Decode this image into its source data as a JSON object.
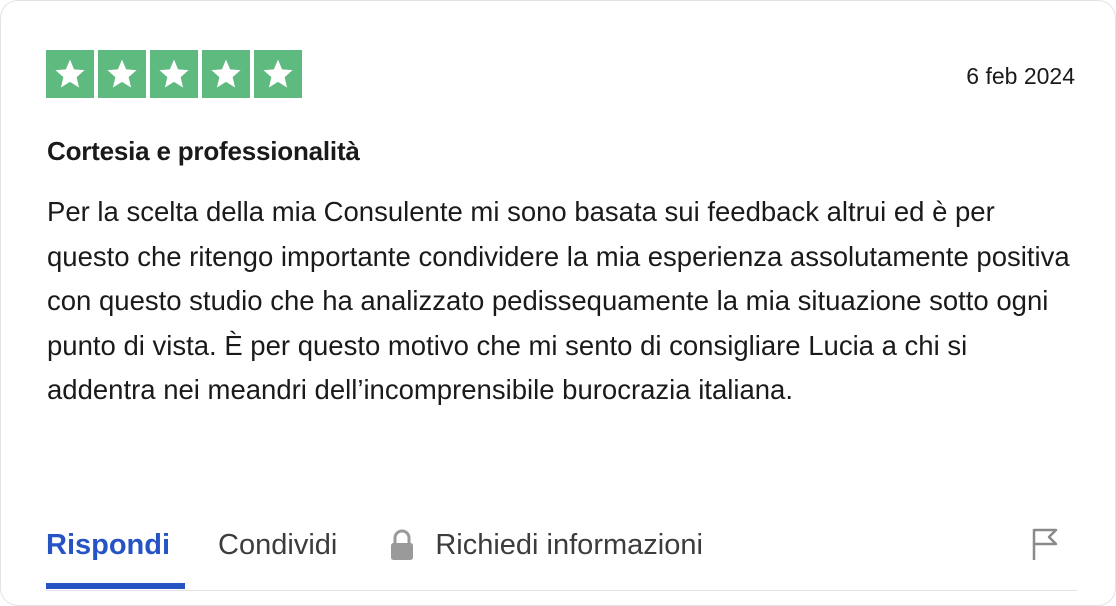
{
  "review": {
    "rating": 5,
    "rating_max": 5,
    "date": "6 feb 2024",
    "title": "Cortesia e professionalità",
    "body": "Per la scelta della mia Consulente mi sono basata sui feedback altrui ed è per questo che ritengo importante condividere la mia esperienza assolutamente positiva con questo studio che ha analizzato pedissequamente la mia situazione sotto ogni punto di vista. È per questo motivo che mi sento di consigliare Lucia a chi si addentra nei meandri dell’incomprensibile burocrazia italiana."
  },
  "actions": {
    "reply_label": "Rispondi",
    "share_label": "Condividi",
    "info_label": "Richiedi informazioni"
  },
  "icons": {
    "star": "star-icon",
    "lock": "lock-icon",
    "flag": "flag-icon"
  },
  "colors": {
    "star_background": "#5fba7f",
    "star": "#ffffff",
    "active_action": "#2754c5",
    "text": "#1a1a1a",
    "muted_icon": "#9a9a9a"
  }
}
